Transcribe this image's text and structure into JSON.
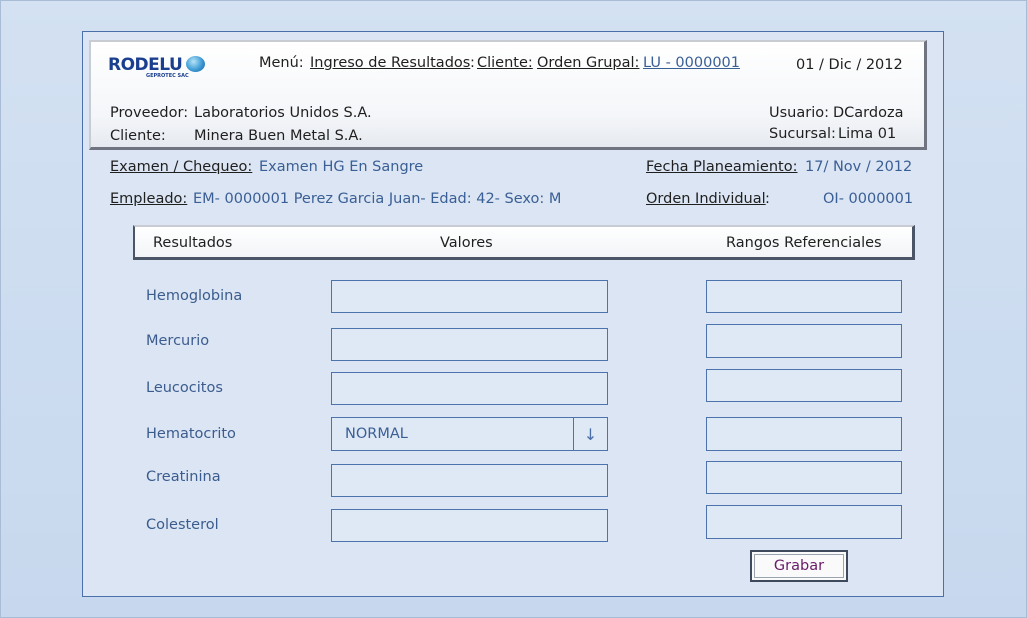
{
  "brand": {
    "logo_text": "RODELU",
    "logo_sub": "GEPROTEC SAC"
  },
  "header": {
    "menu_label": "Menú:",
    "menu_item": "Ingreso de Resultados",
    "sep1": ":",
    "client_link": "Cliente:",
    "group_order_link": "Orden Grupal:",
    "group_order_value": "LU - 0000001",
    "date": "01 / Dic / 2012",
    "provider_label": "Proveedor:",
    "provider_value": "Laboratorios Unidos S.A.",
    "client_label": "Cliente:",
    "client_value": "Minera Buen Metal  S.A.",
    "user_label": "Usuario:",
    "user_value": "DCardoza",
    "branch_label": "Sucursal:",
    "branch_value": "Lima 01"
  },
  "info": {
    "exam_label": "Examen / Chequeo:",
    "exam_value": "Examen HG En Sangre",
    "plan_date_label": "Fecha Planeamiento:",
    "plan_date_value": "17/ Nov / 2012",
    "employee_label": "Empleado:",
    "employee_value": "EM- 0000001  Perez Garcia Juan- Edad: 42- Sexo: M",
    "individual_order_label": "Orden Individual",
    "individual_order_colon": ":",
    "individual_order_value": "OI- 0000001"
  },
  "table": {
    "col_results": "Resultados",
    "col_values": "Valores",
    "col_ranges": "Rangos  Referenciales",
    "rows": [
      {
        "name": "Hemoglobina",
        "value": "",
        "range": ""
      },
      {
        "name": "Mercurio",
        "value": "",
        "range": ""
      },
      {
        "name": "Leucocitos",
        "value": "",
        "range": ""
      },
      {
        "name": "Hematocrito",
        "value": "NORMAL",
        "range": ""
      },
      {
        "name": "Creatinina",
        "value": "",
        "range": ""
      },
      {
        "name": "Colesterol",
        "value": "",
        "range": ""
      }
    ]
  },
  "actions": {
    "save_label": "Grabar"
  },
  "icons": {
    "dropdown": "arrow-down-icon"
  }
}
